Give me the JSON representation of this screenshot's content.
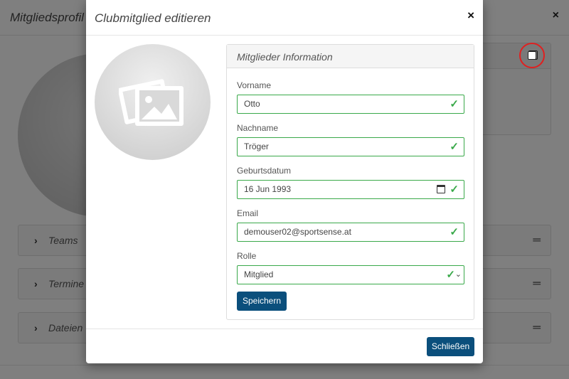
{
  "background": {
    "title": "Mitgliedsprofil",
    "close_glyph": "×",
    "accordions": [
      {
        "label": "Teams"
      },
      {
        "label": "Termine"
      },
      {
        "label": "Dateien"
      }
    ]
  },
  "modal": {
    "title": "Clubmitglied editieren",
    "close_glyph": "×",
    "card_title": "Mitglieder Information",
    "fields": {
      "vorname": {
        "label": "Vorname",
        "value": "Otto"
      },
      "nachname": {
        "label": "Nachname",
        "value": "Tröger"
      },
      "geburtsdatum": {
        "label": "Geburtsdatum",
        "value": "16 Jun 1993"
      },
      "email": {
        "label": "Email",
        "value": "demouser02@sportsense.at"
      },
      "rolle": {
        "label": "Rolle",
        "value": "Mitglied"
      }
    },
    "save_label": "Speichern",
    "close_label": "Schließen"
  },
  "colors": {
    "primary": "#0b4f7c",
    "valid": "#3aa94a",
    "highlight": "#e02020"
  }
}
